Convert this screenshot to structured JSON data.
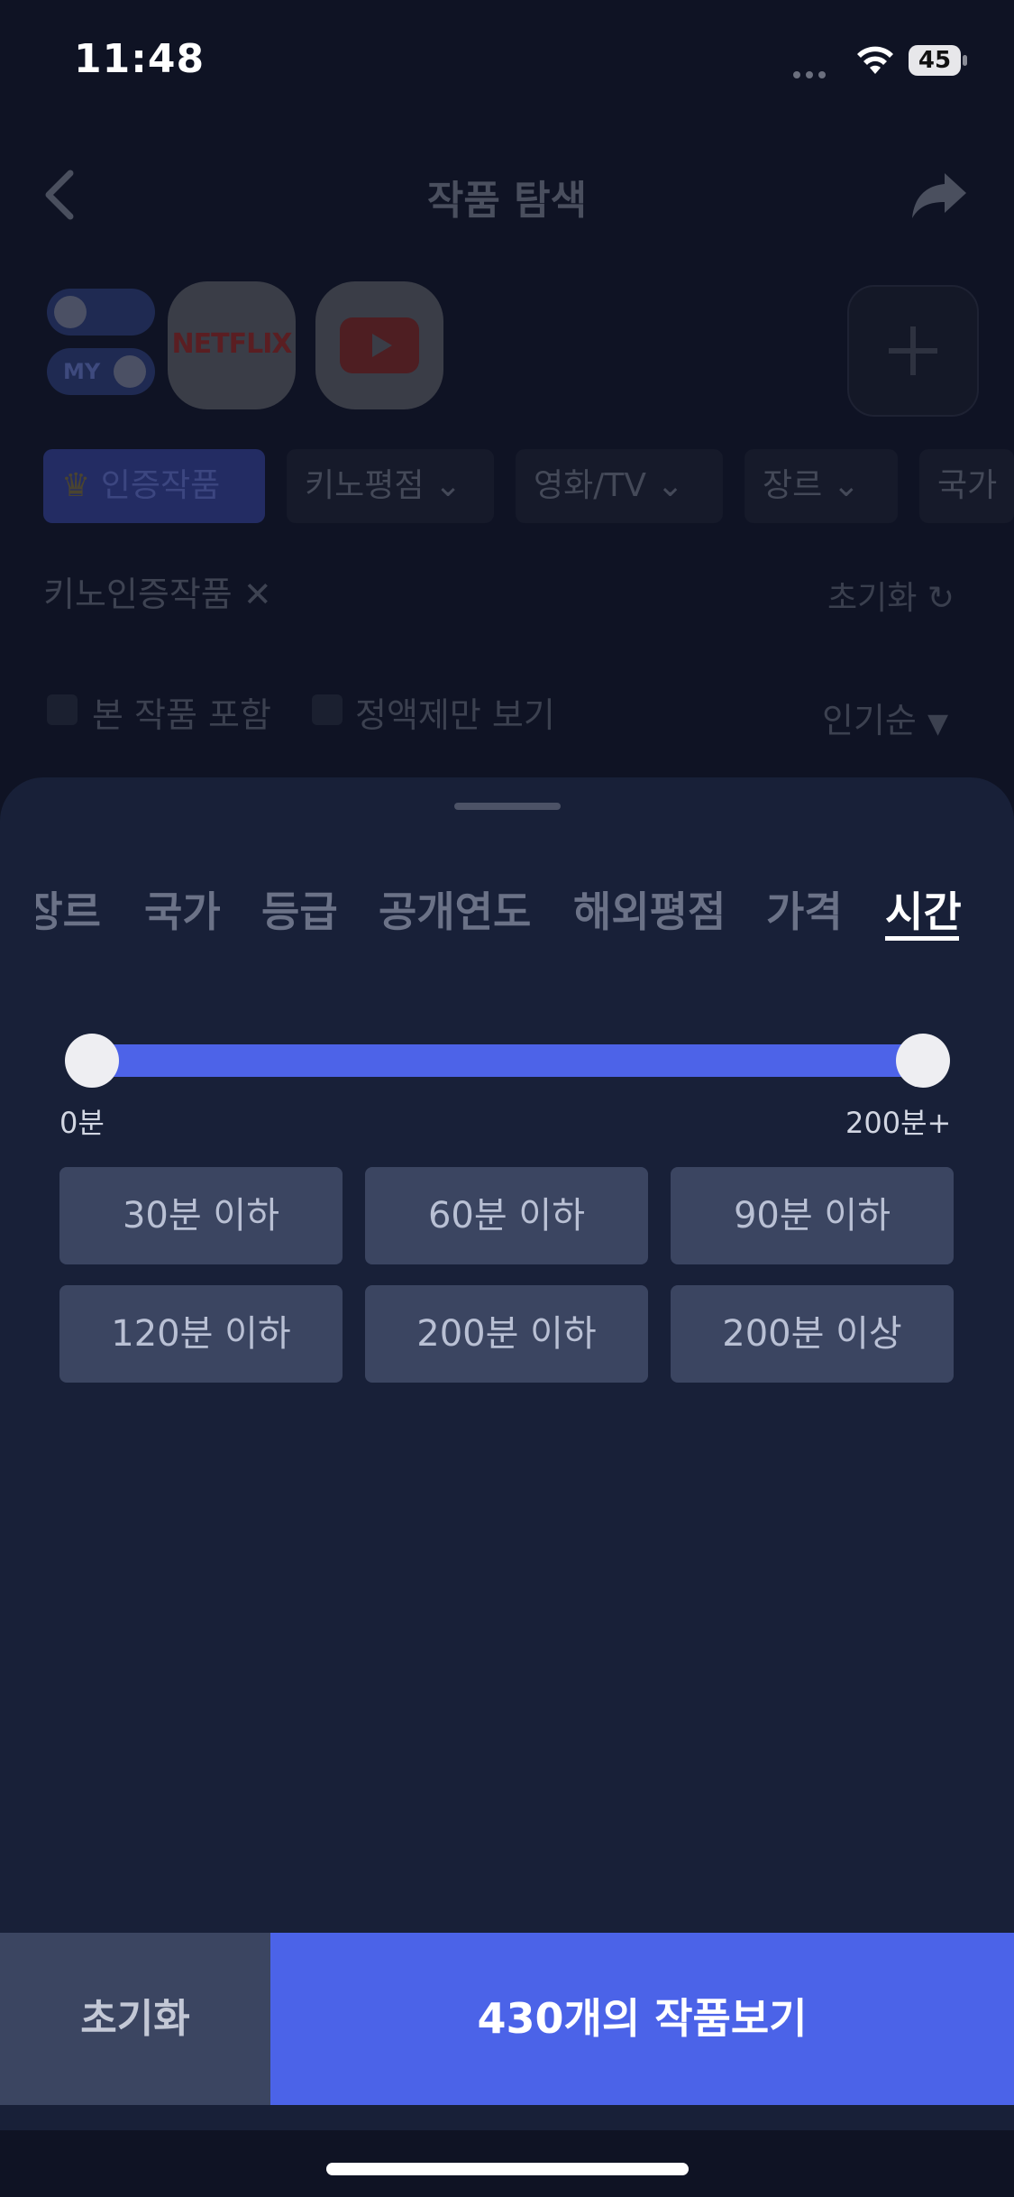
{
  "status_bar": {
    "time": "11:48",
    "battery": "45"
  },
  "header": {
    "title": "작품 탐색"
  },
  "services": {
    "toggle_my_label": "MY",
    "netflix_label": "NETFLIX"
  },
  "filter_chips": [
    {
      "label": "인증작품"
    },
    {
      "label": "키노평점"
    },
    {
      "label": "영화/TV"
    },
    {
      "label": "장르"
    },
    {
      "label": "국가"
    }
  ],
  "active_filter": {
    "label": "키노인증작품",
    "reset_label": "초기화"
  },
  "options": {
    "include_watched": "본 작품 포함",
    "flat_rate_only": "정액제만 보기",
    "sort": "인기순"
  },
  "sheet": {
    "tabs": [
      "장르",
      "국가",
      "등급",
      "공개연도",
      "해외평점",
      "가격",
      "시간"
    ],
    "active_tab": "시간",
    "slider": {
      "min_label": "0분",
      "max_label": "200분+",
      "min_value": 0,
      "max_value": 200,
      "selected_min": 0,
      "selected_max": 200
    },
    "presets": [
      "30분 이하",
      "60분 이하",
      "90분 이하",
      "120분 이하",
      "200분 이하",
      "200분 이상"
    ]
  },
  "actions": {
    "reset_label": "초기화",
    "view_label": "430개의 작품보기"
  },
  "colors": {
    "accent": "#4b63e8",
    "sheet_bg": "#182038",
    "preset_bg": "#3b4561"
  }
}
